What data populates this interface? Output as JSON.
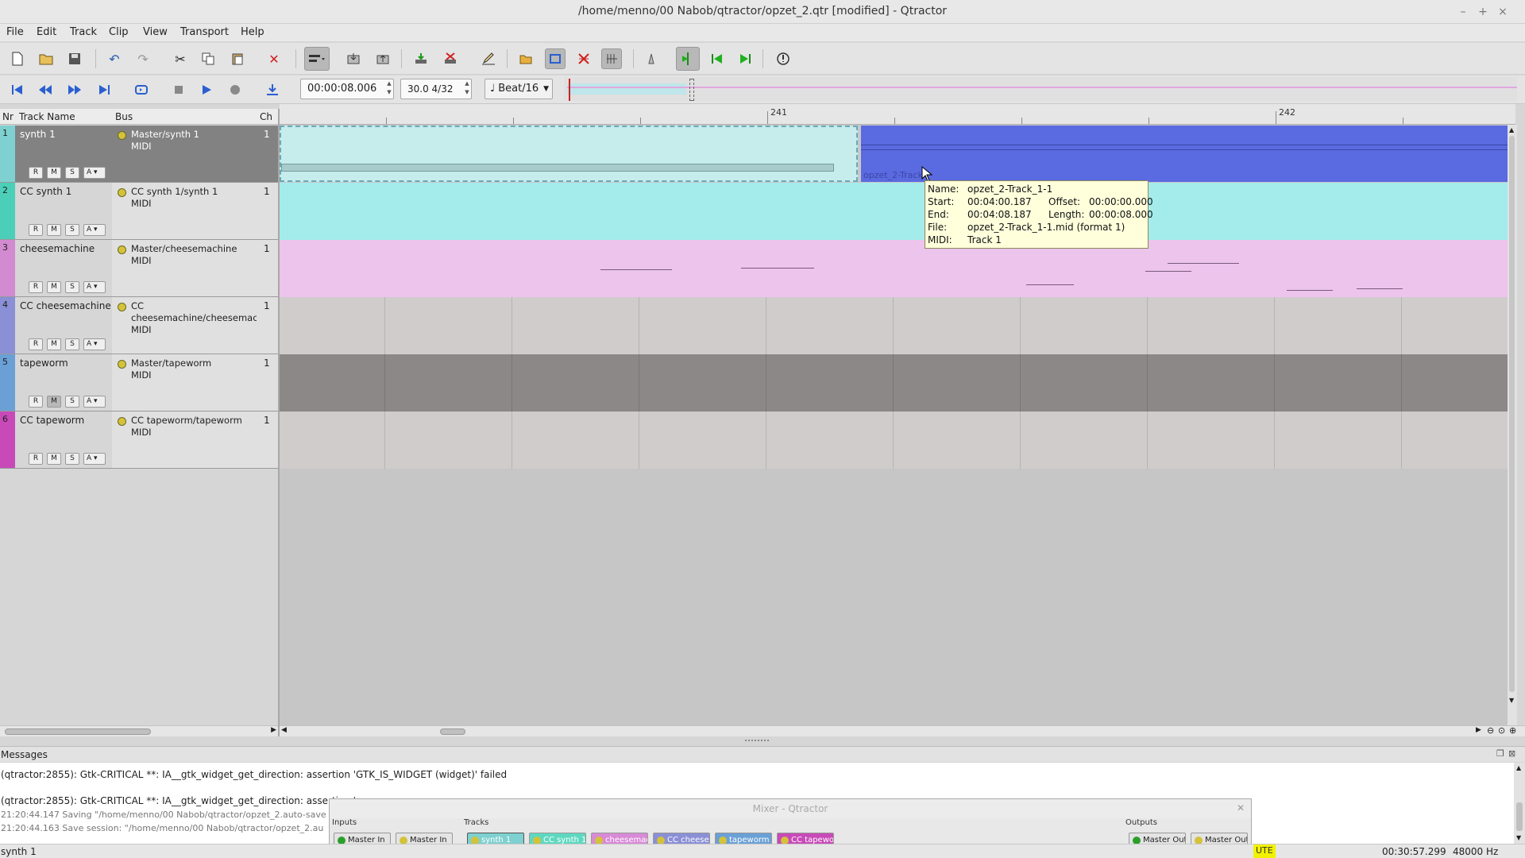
{
  "window": {
    "title": "/home/menno/00 Nabob/qtractor/opzet_2.qtr [modified] - Qtractor",
    "controls": [
      "–",
      "+",
      "×"
    ]
  },
  "menu": [
    "File",
    "Edit",
    "Track",
    "Clip",
    "View",
    "Transport",
    "Help"
  ],
  "toolbar": {
    "time_display": "00:00:08.006",
    "tempo_display": "30.0 4/32",
    "snap_select": "♩ Beat/16",
    "icons": [
      "new-file-icon",
      "open-file-icon",
      "save-icon",
      "undo-icon",
      "redo-icon",
      "cut-icon",
      "copy-icon",
      "paste-icon",
      "delete-icon",
      "clip-tool-icon",
      "import-icon",
      "export-icon",
      "add-track-icon",
      "remove-track-icon",
      "edit-pencil-icon",
      "folder-icon",
      "loop-icon",
      "punch-icon",
      "grid-icon",
      "metronome-icon",
      "follow-playhead-icon",
      "skip-back-icon",
      "skip-forward-icon",
      "panic-icon"
    ]
  },
  "transport": {
    "icons": [
      "rewind-to-start-icon",
      "rewind-icon",
      "fast-forward-icon",
      "forward-to-end-icon",
      "loop-transport-icon",
      "stop-icon",
      "play-icon",
      "record-icon",
      "punch-in-icon"
    ]
  },
  "track_list": {
    "headers": {
      "nr": "Nr",
      "name": "Track Name",
      "bus": "Bus",
      "ch": "Ch"
    },
    "row_buttons": [
      "R",
      "M",
      "S",
      "A"
    ],
    "tracks": [
      {
        "nr": "1",
        "name": "synth 1",
        "bus": [
          "Master/synth 1",
          "MIDI"
        ],
        "ch": "1",
        "color": "#7fd0d0",
        "bg": "#828282"
      },
      {
        "nr": "2",
        "name": "CC synth 1",
        "bus": [
          "CC synth 1/synth 1",
          "MIDI"
        ],
        "ch": "1",
        "color": "#4ccfb8",
        "bg": "#d6d6d6"
      },
      {
        "nr": "3",
        "name": "cheesemachine",
        "bus": [
          "Master/cheesemachine",
          "MIDI"
        ],
        "ch": "1",
        "color": "#d28ad0",
        "bg": "#d6d6d6"
      },
      {
        "nr": "4",
        "name": "CC cheesemachine",
        "bus": [
          "CC",
          "cheesemachine/cheesemachin",
          "MIDI"
        ],
        "ch": "1",
        "color": "#8a8fd6",
        "bg": "#d6d6d6"
      },
      {
        "nr": "5",
        "name": "tapeworm",
        "bus": [
          "Master/tapeworm",
          "MIDI"
        ],
        "ch": "1",
        "color": "#6aa0d6",
        "bg": "#d6d6d6"
      },
      {
        "nr": "6",
        "name": "CC tapeworm",
        "bus": [
          "CC tapeworm/tapeworm",
          "MIDI"
        ],
        "ch": "1",
        "color": "#c84ab8",
        "bg": "#d6d6d6"
      }
    ]
  },
  "timeline": {
    "bar_labels": [
      "241",
      "242"
    ]
  },
  "clip": {
    "label": "opzet_2-Track"
  },
  "tooltip": {
    "rows": [
      {
        "k": "Name:",
        "v": "opzet_2-Track_1-1"
      },
      {
        "k": "Start:",
        "v": "00:04:00.187",
        "k2": "Offset:",
        "v2": "00:00:00.000"
      },
      {
        "k": "End:",
        "v": "00:04:08.187",
        "k2": "Length:",
        "v2": "00:00:08.000"
      },
      {
        "k": "File:",
        "v": "opzet_2-Track_1-1.mid (format 1)"
      },
      {
        "k": "MIDI:",
        "v": "Track 1"
      }
    ]
  },
  "messages": {
    "title": "Messages",
    "lines": [
      "(qtractor:2855): Gtk-CRITICAL **: IA__gtk_widget_get_direction: assertion 'GTK_IS_WIDGET (widget)' failed",
      "(qtractor:2855): Gtk-CRITICAL **: IA__gtk_widget_get_direction: assertion '",
      "21:20:44.147 Saving \"/home/menno/00 Nabob/qtractor/opzet_2.auto-save",
      "21:20:44.163 Save session: \"/home/menno/00 Nabob/qtractor/opzet_2.au"
    ]
  },
  "mixer": {
    "title": "Mixer - Qtractor",
    "sections": {
      "inputs": "Inputs",
      "tracks": "Tracks",
      "outputs": "Outputs"
    },
    "inputs": [
      "Master In",
      "Master In"
    ],
    "tracks": [
      {
        "label": "synth 1",
        "color": "#7fd0d0"
      },
      {
        "label": "CC synth 1",
        "color": "#5fd8c0"
      },
      {
        "label": "cheesemad",
        "color": "#d88ad6"
      },
      {
        "label": "CC cheesen",
        "color": "#8a8fd6"
      },
      {
        "label": "tapeworm",
        "color": "#6aa0d6"
      },
      {
        "label": "CC tapewor",
        "color": "#c84ab8"
      }
    ],
    "outputs": [
      "Master Out",
      "Master Out"
    ]
  },
  "status": {
    "left": "synth 1",
    "indicator": "UTE",
    "time": "00:30:57.299",
    "rate": "48000 Hz"
  }
}
